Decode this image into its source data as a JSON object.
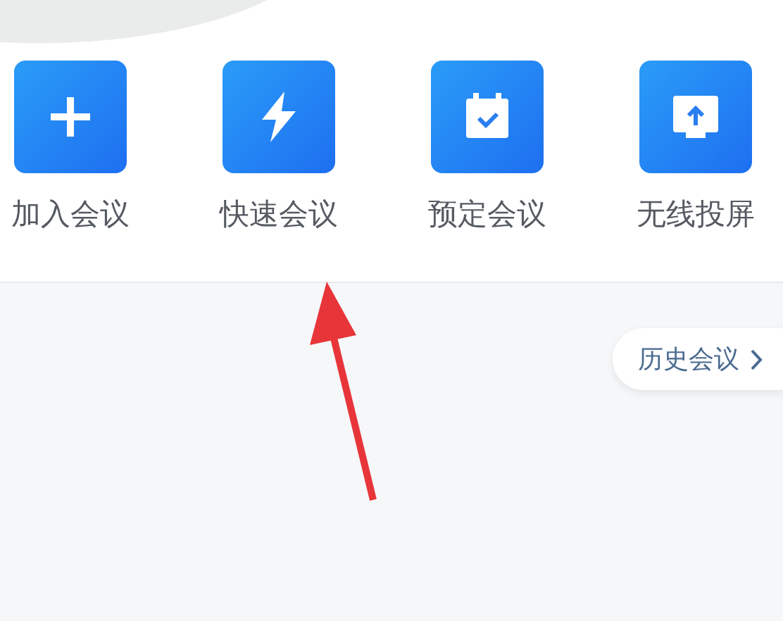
{
  "actions": [
    {
      "label": "加入会议",
      "kind": "join"
    },
    {
      "label": "快速会议",
      "kind": "quick"
    },
    {
      "label": "预定会议",
      "kind": "schedule"
    },
    {
      "label": "无线投屏",
      "kind": "cast"
    }
  ],
  "history_button": {
    "label": "历史会议"
  }
}
